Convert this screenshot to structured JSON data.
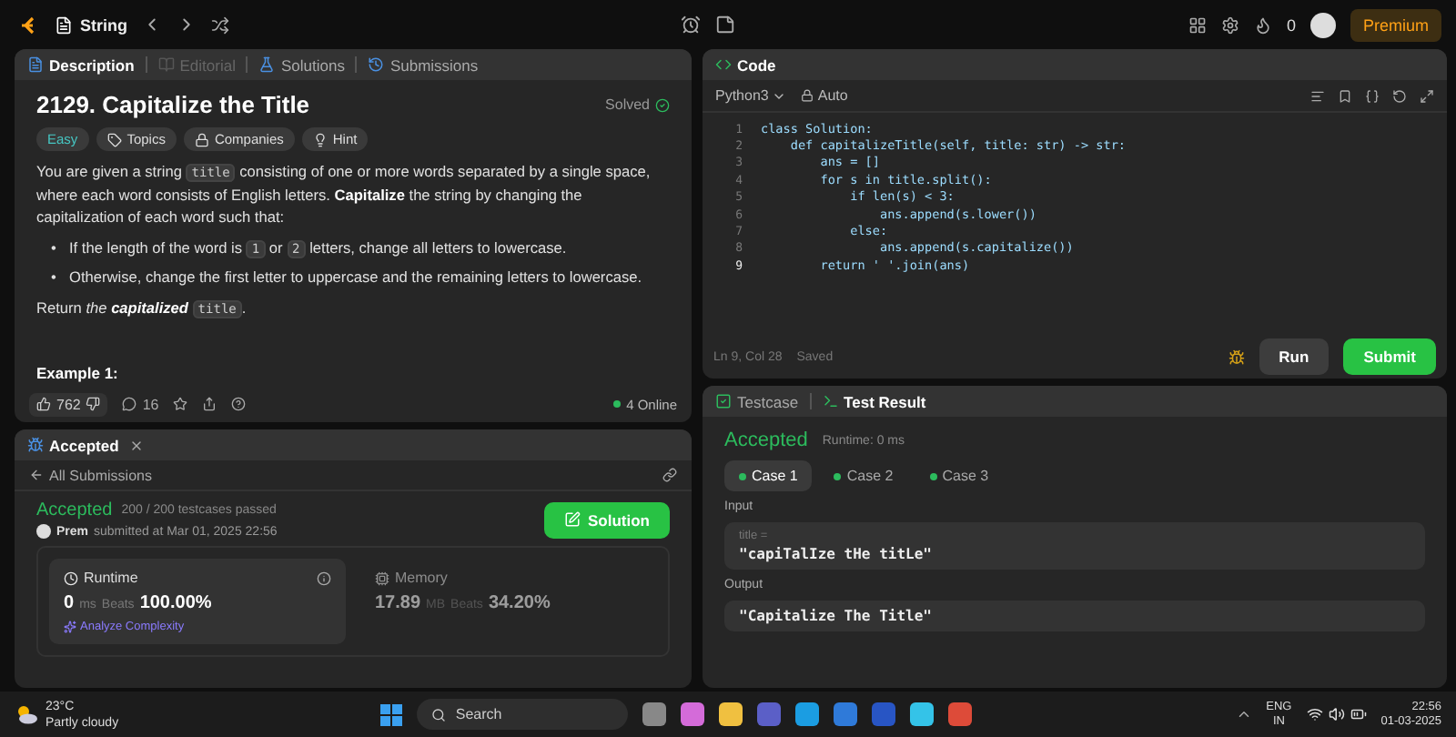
{
  "top_bar": {
    "problem_list": "String",
    "streak": "0",
    "premium": "Premium"
  },
  "description_panel": {
    "tabs": [
      {
        "label": "Description",
        "kind": "description",
        "selected": true,
        "disabled": false
      },
      {
        "label": "Editorial",
        "kind": "editorial",
        "selected": false,
        "disabled": true
      },
      {
        "label": "Solutions",
        "kind": "solutions",
        "selected": false,
        "disabled": false
      },
      {
        "label": "Submissions",
        "kind": "submissions",
        "selected": false,
        "disabled": false
      }
    ],
    "title": "2129. Capitalize the Title",
    "status": "Solved",
    "tags": [
      {
        "label": "Easy",
        "kind": "difficulty"
      },
      {
        "label": "Topics",
        "kind": "topics"
      },
      {
        "label": "Companies",
        "kind": "companies"
      },
      {
        "label": "Hint",
        "kind": "hint"
      }
    ],
    "statement": [
      {
        "kind": "para",
        "parts": [
          {
            "kind": "text",
            "text": "You are given a string "
          },
          {
            "kind": "code",
            "text": "title"
          },
          {
            "kind": "text",
            "text": " consisting of one or more words separated by a single space, where each word consists of English letters. "
          },
          {
            "kind": "bold",
            "text": "Capitalize"
          },
          {
            "kind": "text",
            "text": " the string by changing the capitalization of each word such that:"
          }
        ]
      },
      {
        "kind": "bullet",
        "marker": "•",
        "parts": [
          {
            "kind": "text",
            "text": "If the length of the word is "
          },
          {
            "kind": "code",
            "text": "1"
          },
          {
            "kind": "text",
            "text": " or "
          },
          {
            "kind": "code",
            "text": "2"
          },
          {
            "kind": "text",
            "text": " letters, change all letters to lowercase."
          }
        ]
      },
      {
        "kind": "bullet",
        "marker": "•",
        "parts": [
          {
            "kind": "text",
            "text": "Otherwise, change the first letter to uppercase and the remaining letters to lowercase."
          }
        ]
      },
      {
        "kind": "para",
        "parts": [
          {
            "kind": "text",
            "text": "Return "
          },
          {
            "kind": "italic",
            "text": "the "
          },
          {
            "kind": "bolditalic",
            "text": "capitalized "
          },
          {
            "kind": "code",
            "text": "title"
          },
          {
            "kind": "text",
            "text": "."
          }
        ]
      }
    ],
    "example_heading": "Example 1:",
    "likes": "762",
    "comments": "16",
    "online": "4 Online"
  },
  "code_panel": {
    "title": "Code",
    "language": "Python3",
    "mode": "Auto",
    "lines": [
      {
        "num": "1",
        "text": "class Solution:",
        "current": false
      },
      {
        "num": "2",
        "text": "    def capitalizeTitle(self, title: str) -> str:",
        "current": false
      },
      {
        "num": "3",
        "text": "        ans = []",
        "current": false
      },
      {
        "num": "4",
        "text": "        for s in title.split():",
        "current": false
      },
      {
        "num": "5",
        "text": "            if len(s) < 3:",
        "current": false
      },
      {
        "num": "6",
        "text": "                ans.append(s.lower())",
        "current": false
      },
      {
        "num": "7",
        "text": "            else:",
        "current": false
      },
      {
        "num": "8",
        "text": "                ans.append(s.capitalize())",
        "current": false
      },
      {
        "num": "9",
        "text": "        return ' '.join(ans)",
        "current": true
      }
    ],
    "cursor": "Ln 9, Col 28",
    "save_state": "Saved",
    "run": "Run",
    "submit": "Submit"
  },
  "submission_panel": {
    "tab": "Accepted",
    "back": "All Submissions",
    "status": "Accepted",
    "passed": "200 / 200 testcases passed",
    "user": "Prem",
    "submitted": "submitted at Mar 01, 2025 22:56",
    "solution": "Solution",
    "metrics": [
      {
        "kind": "runtime",
        "label": "Runtime",
        "value": "0",
        "unit": "ms",
        "beats_label": "Beats",
        "beats": "100.00%",
        "selected": true,
        "link": "Analyze Complexity"
      },
      {
        "kind": "memory",
        "label": "Memory",
        "value": "17.89",
        "unit": "MB",
        "beats_label": "Beats",
        "beats": "34.20%",
        "selected": false
      }
    ]
  },
  "result_panel": {
    "tabs": [
      {
        "label": "Testcase",
        "kind": "testcase",
        "selected": false
      },
      {
        "label": "Test Result",
        "kind": "result",
        "selected": true
      }
    ],
    "status": "Accepted",
    "runtime": "Runtime: 0 ms",
    "cases": [
      {
        "label": "Case 1",
        "selected": true
      },
      {
        "label": "Case 2",
        "selected": false
      },
      {
        "label": "Case 3",
        "selected": false
      }
    ],
    "input_label": "Input",
    "input_var": "title =",
    "input_value": "\"capiTalIze tHe titLe\"",
    "output_label": "Output",
    "output_value": "\"Capitalize The Title\""
  },
  "taskbar": {
    "temperature": "23°C",
    "weather": "Partly cloudy",
    "search": "Search",
    "lang": "ENG",
    "region": "IN",
    "time": "22:56",
    "date": "01-03-2025"
  }
}
